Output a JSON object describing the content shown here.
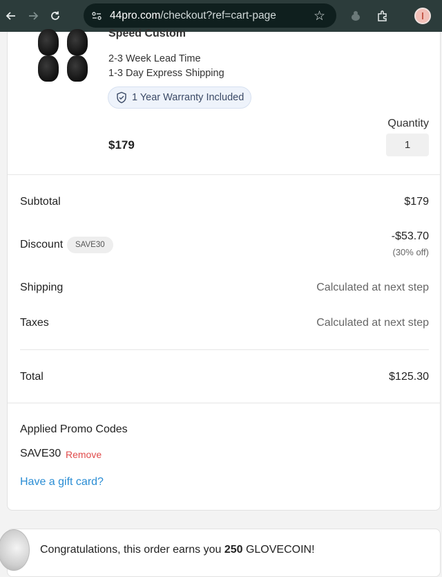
{
  "browser": {
    "url_host": "44pro.com",
    "url_path": "/checkout?ref=cart-page"
  },
  "product": {
    "name": "Speed Custom",
    "lead_time": "2-3 Week Lead Time",
    "shipping": "1-3 Day Express Shipping",
    "warranty": "1 Year Warranty Included",
    "price": "$179",
    "quantity_label": "Quantity",
    "quantity": "1"
  },
  "summary": {
    "subtotal_label": "Subtotal",
    "subtotal_value": "$179",
    "discount_label": "Discount",
    "discount_code": "SAVE30",
    "discount_value": "-$53.70",
    "discount_pct": "(30% off)",
    "shipping_label": "Shipping",
    "shipping_value": "Calculated at next step",
    "taxes_label": "Taxes",
    "taxes_value": "Calculated at next step",
    "total_label": "Total",
    "total_value": "$125.30"
  },
  "promo": {
    "title": "Applied Promo Codes",
    "code": "SAVE30",
    "remove_label": "Remove",
    "gift_card_label": "Have a gift card?"
  },
  "coins": {
    "message_prefix": "Congratulations, this order earns you ",
    "amount": "250",
    "message_suffix": " GLOVECOIN!"
  },
  "colors": {
    "browser_bar": "#2c3c3b",
    "link_blue": "#2a8dd4",
    "remove_red": "#e04b4b"
  }
}
